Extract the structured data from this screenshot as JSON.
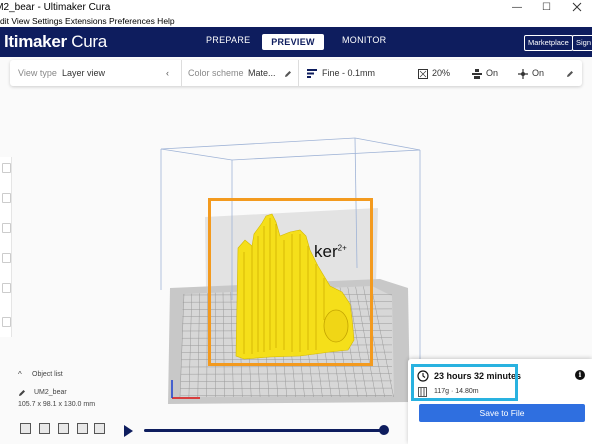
{
  "window": {
    "title": "UM2_bear - Ultimaker Cura",
    "minimize": "—",
    "maximize": "☐"
  },
  "menu": [
    "Edit",
    "View",
    "Settings",
    "Extensions",
    "Preferences",
    "Help"
  ],
  "menu_visible": "dit View Settings Extensions Preferences Help",
  "header": {
    "logo_bold": "ltimaker",
    "logo_light": " Cura",
    "stages": [
      {
        "label": "PREPARE"
      },
      {
        "label": "PREVIEW"
      },
      {
        "label": "MONITOR"
      }
    ],
    "marketplace": "Marketplace",
    "signin": "Sign"
  },
  "toolbar": {
    "view_type_label": "View type",
    "view_type_value": "Layer view",
    "color_scheme_label": "Color scheme",
    "color_scheme_value": "Mate...",
    "profile": "Fine - 0.1mm",
    "infill": "20%",
    "support": "On",
    "adhesion": "On"
  },
  "build_plate": {
    "printer_label": "ker",
    "printer_super": "2+"
  },
  "object_panel": {
    "header": "Object list",
    "object_name": "UM2_bear",
    "dimensions": "105.7 x 98.1 x 130.0 mm"
  },
  "print_info": {
    "time": "23 hours 32 minutes",
    "material": "117g · 14.80m",
    "save_label": "Save to File",
    "info_glyph": "i"
  },
  "colors": {
    "header_bg": "#0e1d5e",
    "accent_blue": "#2f6fe0",
    "model_yellow": "#f5df1a",
    "highlight_orange": "#f39a1e",
    "highlight_cyan": "#29b2e0"
  }
}
